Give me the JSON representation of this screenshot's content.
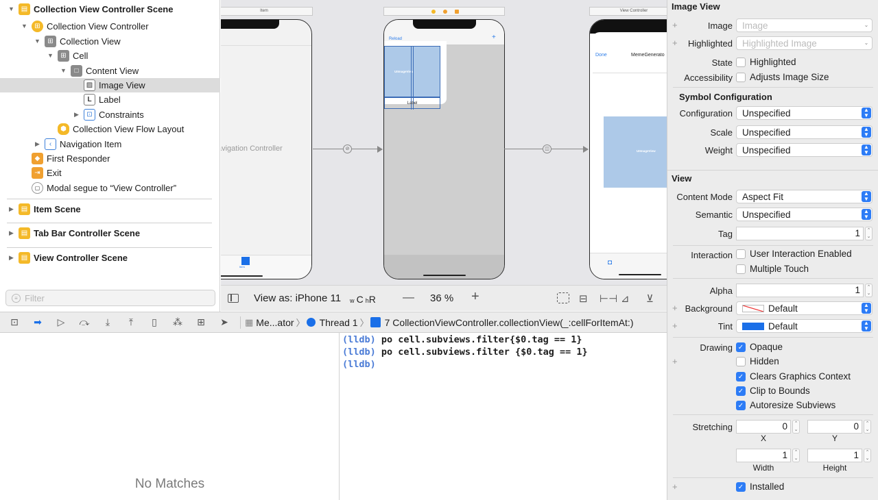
{
  "outline": {
    "items": [
      {
        "label": "Collection View Controller Scene",
        "bold": true
      },
      {
        "label": "Collection View Controller"
      },
      {
        "label": "Collection View"
      },
      {
        "label": "Cell"
      },
      {
        "label": "Content View"
      },
      {
        "label": "Image View"
      },
      {
        "label": "Label"
      },
      {
        "label": "Constraints"
      },
      {
        "label": "Collection View Flow Layout"
      },
      {
        "label": "Navigation Item"
      },
      {
        "label": "First Responder"
      },
      {
        "label": "Exit"
      },
      {
        "label": "Modal segue to “View Controller”"
      },
      {
        "label": "Item Scene"
      },
      {
        "label": "Tab Bar Controller Scene"
      },
      {
        "label": "View Controller Scene"
      }
    ],
    "filter_placeholder": "Filter",
    "label_icon_glyph": "L"
  },
  "canvas": {
    "item_scene_title": "Item",
    "view_controller_title": "View Controller",
    "nav_controller_label": "avigation Controller",
    "tab_item_label": "Item",
    "reload": "Reload",
    "add": "+",
    "uiimageview": "UIImageView",
    "cell_label": "Label",
    "done": "Done",
    "meme_title": "MemeGenerato",
    "uiimageview2": "UIImageView"
  },
  "canvas_toolbar": {
    "view_as": "View as: iPhone 11",
    "size_class_w": "w",
    "size_class_wval": "C",
    "size_class_h": "h",
    "size_class_hval": "R",
    "zoom": "36 %",
    "minus": "—",
    "plus": "+"
  },
  "debug_bar": {
    "breadcrumb_app": "Me...ator",
    "thread": "Thread 1",
    "frame": "7 CollectionViewController.collectionView(_:cellForItemAt:)"
  },
  "variables": {
    "empty": "No Matches"
  },
  "console": {
    "lines": [
      {
        "prompt": "(lldb)",
        "cmd": "po cell.subviews.filter{$0.tag == 1}"
      },
      {
        "prompt": "(lldb)",
        "cmd": "po cell.subviews.filter {$0.tag == 1}"
      },
      {
        "prompt": "(lldb)",
        "cmd": ""
      }
    ]
  },
  "inspector": {
    "image_view_header": "Image View",
    "image_label": "Image",
    "image_placeholder": "Image",
    "highlighted_label": "Highlighted",
    "highlighted_placeholder": "Highlighted Image",
    "state_label": "State",
    "state_cb": "Highlighted",
    "accessibility_label": "Accessibility",
    "accessibility_cb": "Adjusts Image Size",
    "symbol_header": "Symbol Configuration",
    "configuration_label": "Configuration",
    "configuration_value": "Unspecified",
    "scale_label": "Scale",
    "scale_value": "Unspecified",
    "weight_label": "Weight",
    "weight_value": "Unspecified",
    "view_header": "View",
    "content_mode_label": "Content Mode",
    "content_mode_value": "Aspect Fit",
    "semantic_label": "Semantic",
    "semantic_value": "Unspecified",
    "tag_label": "Tag",
    "tag_value": "1",
    "interaction_label": "Interaction",
    "user_interaction": "User Interaction Enabled",
    "multiple_touch": "Multiple Touch",
    "alpha_label": "Alpha",
    "alpha_value": "1",
    "background_label": "Background",
    "background_value": "Default",
    "tint_label": "Tint",
    "tint_value": "Default",
    "tint_color": "#1a6fe8",
    "drawing_label": "Drawing",
    "opaque": "Opaque",
    "hidden": "Hidden",
    "clears": "Clears Graphics Context",
    "clip": "Clip to Bounds",
    "autoresize": "Autoresize Subviews",
    "stretching_label": "Stretching",
    "x_value": "0",
    "y_value": "0",
    "x_sub": "X",
    "y_sub": "Y",
    "width_value": "1",
    "height_value": "1",
    "width_sub": "Width",
    "height_sub": "Height",
    "installed": "Installed",
    "checkmark": "✓"
  },
  "colors": {
    "accent": "#2d7cf6",
    "prompt": "#4a7bd6",
    "selection": "#dcdcdc"
  }
}
